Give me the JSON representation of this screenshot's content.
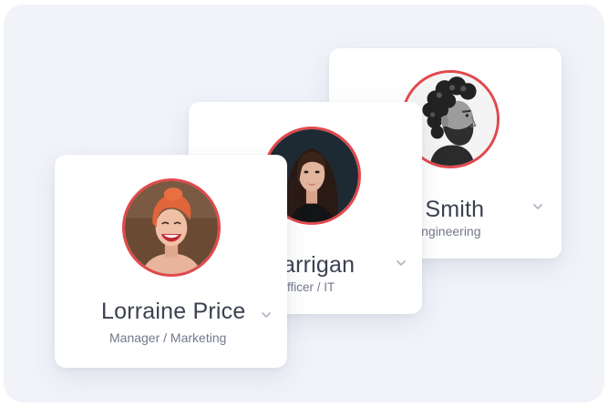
{
  "profiles": {
    "back": {
      "name": "ob Smith",
      "role": "/ Engineering"
    },
    "middle": {
      "name": "Marrigan",
      "role": ": Officer / IT"
    },
    "front": {
      "name": "Lorraine Price",
      "role": "Manager / Marketing"
    }
  },
  "icons": {
    "expand": "chevron-down-icon",
    "photo": "avatar-photo"
  },
  "colors": {
    "background": "#f1f3f9",
    "card": "#ffffff",
    "avatar_ring": "#e0494d",
    "name_text": "#3c4150",
    "role_text": "#72798a",
    "chevron": "#b2b7c4"
  }
}
